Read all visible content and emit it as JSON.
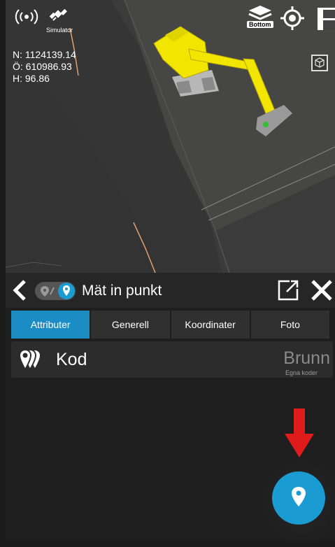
{
  "status_bar": {
    "gnss_icon": "signal-broadcast-icon",
    "satellite_icon": "satellite-icon",
    "simulator_label": "Simulator",
    "layers_icon": "layers-icon",
    "layer_badge": "Bottom",
    "locate_icon": "crosshair-icon",
    "layout_icon": "layout-icon"
  },
  "coordinates": {
    "north": "N: 1124139.14",
    "east": "Ö: 610986.93",
    "height": "H: 96.86"
  },
  "view_cube_icon": "cube-icon",
  "header": {
    "back_icon": "chevron-left-icon",
    "title": "Mät in punkt",
    "open_icon": "external-link-icon",
    "close_icon": "close-icon"
  },
  "tabs": [
    {
      "label": "Attributer",
      "active": true
    },
    {
      "label": "Generell",
      "active": false
    },
    {
      "label": "Koordinater",
      "active": false
    },
    {
      "label": "Foto",
      "active": false
    }
  ],
  "attribute_row": {
    "label": "Kod",
    "value": "Brunn",
    "sub": "Egna koder",
    "icon": "stacked-pins-icon"
  },
  "fab_icon": "map-pin-icon",
  "colors": {
    "accent": "#1b8dc4",
    "fab": "#1a9bd1",
    "arrow": "#e01b1b",
    "excavator": "#f2e600"
  }
}
